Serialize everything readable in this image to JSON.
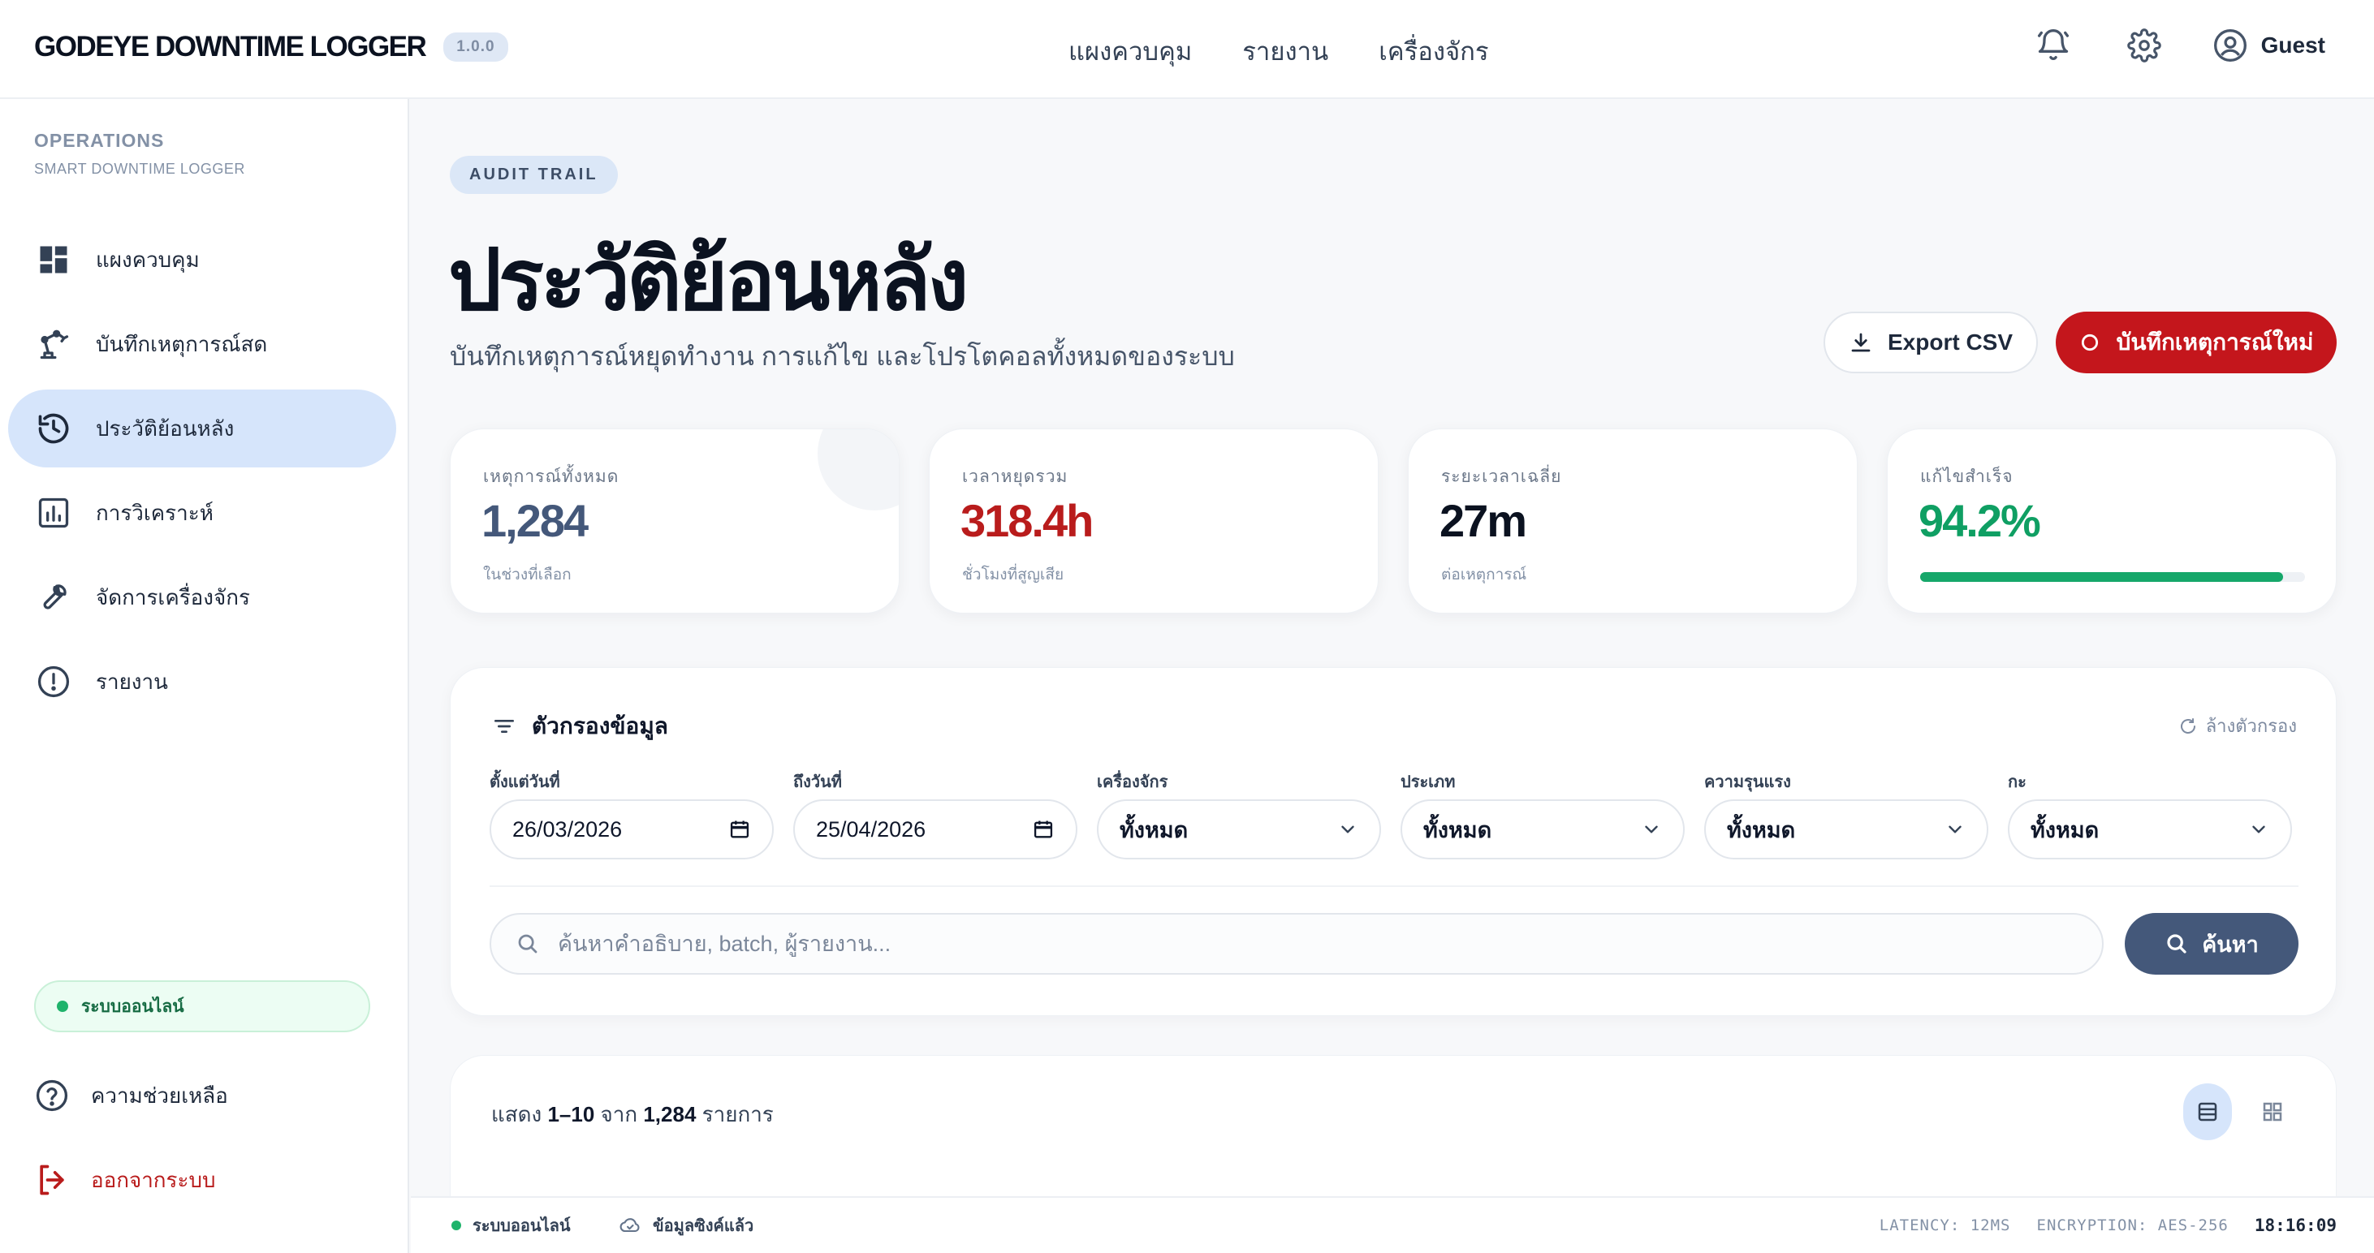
{
  "app": {
    "title": "GODEYE DOWNTIME LOGGER",
    "version": "1.0.0"
  },
  "topnav": [
    "แผงควบคุม",
    "รายงาน",
    "เครื่องจักร"
  ],
  "user": {
    "name": "Guest"
  },
  "sidebar": {
    "section_title": "OPERATIONS",
    "section_sub": "SMART DOWNTIME LOGGER",
    "items": [
      {
        "label": "แผงควบคุม",
        "icon": "dashboard-icon"
      },
      {
        "label": "บันทึกเหตุการณ์สด",
        "icon": "robot-arm-icon"
      },
      {
        "label": "ประวัติย้อนหลัง",
        "icon": "history-icon",
        "active": true
      },
      {
        "label": "การวิเคราะห์",
        "icon": "analytics-icon"
      },
      {
        "label": "จัดการเครื่องจักร",
        "icon": "wrench-icon"
      },
      {
        "label": "รายงาน",
        "icon": "alert-circle-icon"
      }
    ],
    "status": "ระบบออนไลน์",
    "help": "ความช่วยเหลือ",
    "logout": "ออกจากระบบ"
  },
  "page": {
    "badge": "AUDIT TRAIL",
    "title": "ประวัติย้อนหลัง",
    "subtitle": "บันทึกเหตุการณ์หยุดทำงาน การแก้ไข และโปรโตคอลทั้งหมดของระบบ",
    "export_label": "Export CSV",
    "new_label": "บันทึกเหตุการณ์ใหม่"
  },
  "stats": [
    {
      "title": "เหตุการณ์ทั้งหมด",
      "value": "1,284",
      "sub": "ในช่วงที่เลือก",
      "color": "#44587a"
    },
    {
      "title": "เวลาหยุดรวม",
      "value": "318.4h",
      "sub": "ชั่วโมงที่สูญเสีย",
      "color": "#b91c1c"
    },
    {
      "title": "ระยะเวลาเฉลี่ย",
      "value": "27m",
      "sub": "ต่อเหตุการณ์",
      "color": "#0b1220"
    },
    {
      "title": "แก้ไขสำเร็จ",
      "value": "94.2%",
      "progress": 0.942,
      "color": "#0f9f63"
    }
  ],
  "filters": {
    "title": "ตัวกรองข้อมูล",
    "clear_label": "ล้างตัวกรอง",
    "fields": [
      {
        "label": "ตั้งแต่วันที่",
        "value": "26/03/2026",
        "kind": "date"
      },
      {
        "label": "ถึงวันที่",
        "value": "25/04/2026",
        "kind": "date"
      },
      {
        "label": "เครื่องจักร",
        "value": "ทั้งหมด",
        "kind": "select"
      },
      {
        "label": "ประเภท",
        "value": "ทั้งหมด",
        "kind": "select"
      },
      {
        "label": "ความรุนแรง",
        "value": "ทั้งหมด",
        "kind": "select"
      },
      {
        "label": "กะ",
        "value": "ทั้งหมด",
        "kind": "select"
      }
    ],
    "search_placeholder": "ค้นหาคำอธิบาย, batch, ผู้รายงาน...",
    "search_button": "ค้นหา"
  },
  "list": {
    "prefix": "แสดง",
    "range": "1–10",
    "mid": "จาก",
    "total": "1,284",
    "suffix": "รายการ"
  },
  "statusbar": {
    "online": "ระบบออนไลน์",
    "sync": "ข้อมูลซิงค์แล้ว",
    "latency": "LATENCY: 12MS",
    "encryption": "ENCRYPTION: AES-256",
    "clock": "18:16:09"
  }
}
